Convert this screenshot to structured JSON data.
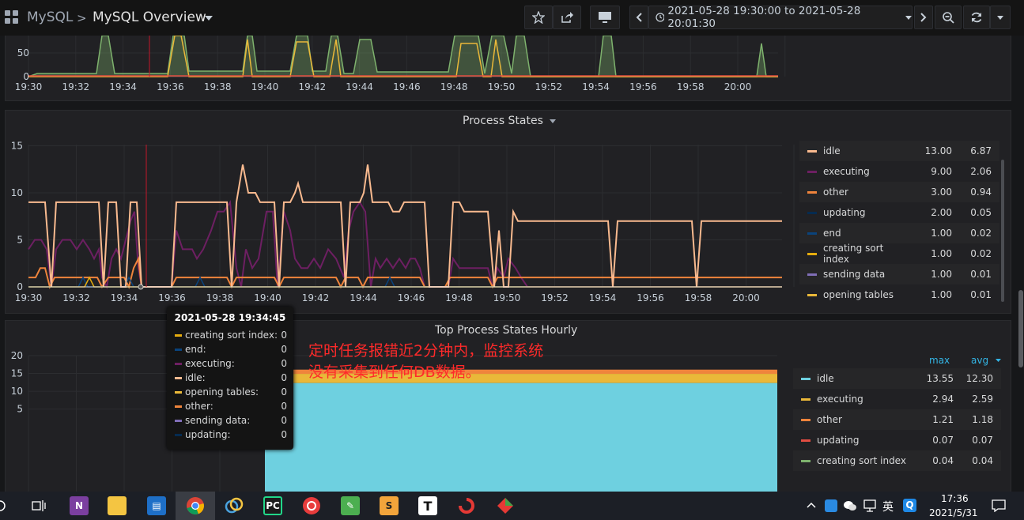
{
  "nav": {
    "folder": "MySQL",
    "separator": ">",
    "dashboard": "MySQL Overview",
    "time_range": "2021-05-28 19:30:00 to 2021-05-28 20:01:30"
  },
  "top_panel": {
    "y_ticks": [
      "50",
      "0"
    ],
    "x_ticks": [
      "19:30",
      "19:32",
      "19:34",
      "19:36",
      "19:38",
      "19:40",
      "19:42",
      "19:44",
      "19:46",
      "19:48",
      "19:50",
      "19:52",
      "19:54",
      "19:56",
      "19:58",
      "20:00"
    ]
  },
  "process_states": {
    "title": "Process States",
    "y_ticks": [
      "15",
      "10",
      "5",
      "0"
    ],
    "x_ticks": [
      "19:30",
      "19:32",
      "19:34",
      "19:36",
      "19:38",
      "19:40",
      "19:42",
      "19:44",
      "19:46",
      "19:48",
      "19:50",
      "19:52",
      "19:54",
      "19:56",
      "19:58",
      "20:00"
    ],
    "legend": [
      {
        "name": "idle",
        "max": "13.00",
        "avg": "6.87",
        "color": "#f9ba8f"
      },
      {
        "name": "executing",
        "max": "9.00",
        "avg": "2.06",
        "color": "#6d1f62"
      },
      {
        "name": "other",
        "max": "3.00",
        "avg": "0.94",
        "color": "#ef843c"
      },
      {
        "name": "updating",
        "max": "2.00",
        "avg": "0.05",
        "color": "#052b51"
      },
      {
        "name": "end",
        "max": "1.00",
        "avg": "0.02",
        "color": "#0a437c"
      },
      {
        "name": "creating sort index",
        "max": "1.00",
        "avg": "0.02",
        "color": "#e5ac0e"
      },
      {
        "name": "sending data",
        "max": "1.00",
        "avg": "0.01",
        "color": "#806eb7"
      },
      {
        "name": "opening tables",
        "max": "1.00",
        "avg": "0.01",
        "color": "#eab839"
      }
    ]
  },
  "hourly": {
    "title": "Top Process States Hourly",
    "y_ticks": [
      "20",
      "15",
      "10",
      "5"
    ],
    "col_max": "max",
    "col_avg": "avg",
    "legend": [
      {
        "name": "idle",
        "max": "13.55",
        "avg": "12.30",
        "color": "#6ed0e0"
      },
      {
        "name": "executing",
        "max": "2.94",
        "avg": "2.59",
        "color": "#eab839"
      },
      {
        "name": "other",
        "max": "1.21",
        "avg": "1.18",
        "color": "#ef843c"
      },
      {
        "name": "updating",
        "max": "0.07",
        "avg": "0.07",
        "color": "#e24d42"
      },
      {
        "name": "creating sort index",
        "max": "0.04",
        "avg": "0.04",
        "color": "#7eb26d"
      }
    ]
  },
  "tooltip": {
    "time": "2021-05-28 19:34:45",
    "rows": [
      {
        "label": "creating sort index:",
        "value": "0",
        "color": "#e5ac0e"
      },
      {
        "label": "end:",
        "value": "0",
        "color": "#0a437c"
      },
      {
        "label": "executing:",
        "value": "0",
        "color": "#6d1f62"
      },
      {
        "label": "idle:",
        "value": "0",
        "color": "#f9ba8f"
      },
      {
        "label": "opening tables:",
        "value": "0",
        "color": "#eab839"
      },
      {
        "label": "other:",
        "value": "0",
        "color": "#ef843c"
      },
      {
        "label": "sending data:",
        "value": "0",
        "color": "#806eb7"
      },
      {
        "label": "updating:",
        "value": "0",
        "color": "#052b51"
      }
    ]
  },
  "annotation": {
    "line1": "定时任务报错近2分钟内，监控系统",
    "line2": "没有采集到任何DB数据。"
  },
  "taskbar": {
    "clock_time": "17:36",
    "clock_date": "2021/5/31",
    "ime": "英",
    "icons": [
      "cortana-icon",
      "task-view-icon",
      "onenote-icon",
      "file-explorer-icon",
      "news-icon",
      "chrome-icon",
      "app-icon",
      "pycharm-icon",
      "netease-music-icon",
      "notepad-icon",
      "sublime-icon",
      "typora-icon",
      "app2-icon",
      "app3-icon"
    ]
  }
}
